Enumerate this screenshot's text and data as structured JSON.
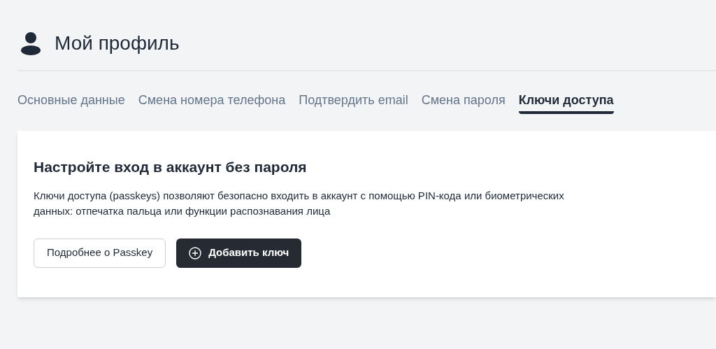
{
  "header": {
    "title": "Мой профиль"
  },
  "tabs": [
    {
      "label": "Основные данные",
      "selected": false
    },
    {
      "label": "Смена номера телефона",
      "selected": false
    },
    {
      "label": "Подтвердить email",
      "selected": false
    },
    {
      "label": "Смена пароля",
      "selected": false
    },
    {
      "label": "Ключи доступа",
      "selected": true
    }
  ],
  "card": {
    "heading": "Настройте вход в аккаунт без пароля",
    "description": "Ключи доступа (passkeys) позволяют безопасно входить в аккаунт с помощью PIN-кода или биометрических данных: отпечатка пальца или функции распознавания лица",
    "buttons": [
      {
        "label": "Подробнее о Passkey",
        "kind": "secondary"
      },
      {
        "label": "Добавить ключ",
        "kind": "primary"
      }
    ]
  }
}
